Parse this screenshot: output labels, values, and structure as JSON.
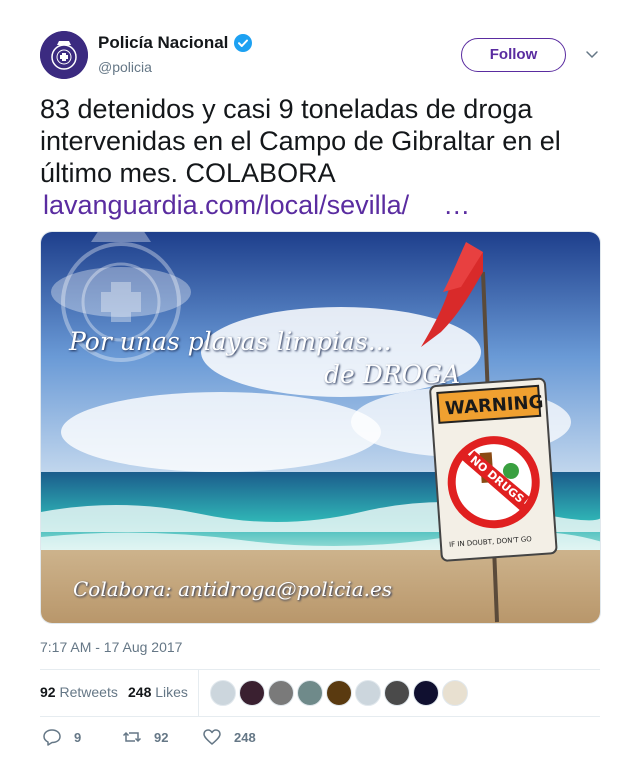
{
  "user": {
    "display_name": "Policía Nacional",
    "handle": "@policia",
    "follow_label": "Follow",
    "verified_icon": "verified-badge-icon"
  },
  "tweet": {
    "text": "83 detenidos y casi 9 toneladas de droga intervenidas en el Campo de Gibraltar en el último mes. COLABORA",
    "link": "lavanguardia.com/local/sevilla/",
    "ellipsis": "…",
    "timestamp": "7:17 AM - 17 Aug 2017"
  },
  "media": {
    "headline_line1": "Por unas playas limpias...",
    "headline_line2": "de DROGA",
    "sign_warning": "WARNING",
    "sign_no_drugs": "NO DRUGS",
    "sign_footer": "IF IN DOUBT, DON'T GO",
    "contact": "Colabora: antidroga@policia.es"
  },
  "stats": {
    "retweets_count": "92",
    "retweets_label": "Retweets",
    "likes_count": "248",
    "likes_label": "Likes"
  },
  "actions": {
    "reply_count": "9",
    "retweet_count": "92",
    "like_count": "248"
  },
  "colors": {
    "accent": "#5a2ca0",
    "muted": "#657786",
    "verified": "#1da1f2"
  }
}
